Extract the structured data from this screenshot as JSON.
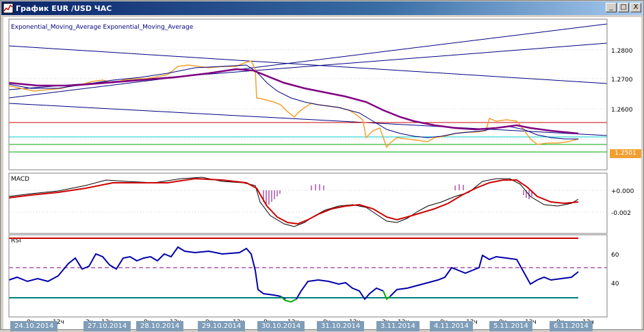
{
  "window": {
    "title": "График EUR /USD  ЧАС",
    "btn_min": "_",
    "btn_max": "□",
    "btn_close": "X"
  },
  "main_panel": {
    "legend": "Exponential_Moving_Average Exponential_Moving_Average",
    "y_ticks": [
      "1.2800",
      "1.2700",
      "1.2600"
    ],
    "current_price": "1.2501"
  },
  "macd_panel": {
    "title": "MACD",
    "y_ticks": [
      "+0.000",
      "-0.002"
    ]
  },
  "rsi_panel": {
    "title": "RSI",
    "y_ticks": [
      "60",
      "40"
    ]
  },
  "x_axis": {
    "dates": [
      "24.10.2014",
      "27.10.2014",
      "28.10.2014",
      "29.10.2014",
      "30.10.2014",
      "31.10.2014",
      "3.11.2014",
      "4.11.2014",
      "5.11.2014",
      "6.11.2014"
    ],
    "hour_labels": [
      "0ч",
      "12ч",
      "3ч",
      "12ч",
      "0ч",
      "12ч",
      "0ч",
      "12ч",
      "0ч",
      "12ч",
      "0ч",
      "12ч",
      "3ч",
      "12ч",
      "0ч",
      "12ч",
      "0ч",
      "12ч",
      "0ч",
      "12ч"
    ]
  },
  "colors": {
    "price": "#f0a030",
    "ema_fast": "#000080",
    "ema_slow": "#800080",
    "macd_signal": "#cc0000",
    "rsi": "#0000aa",
    "rsi_low": "#00aa00",
    "support_red": "#cc0000",
    "support_cyan": "#00cccc",
    "support_green": "#00aa00"
  }
}
